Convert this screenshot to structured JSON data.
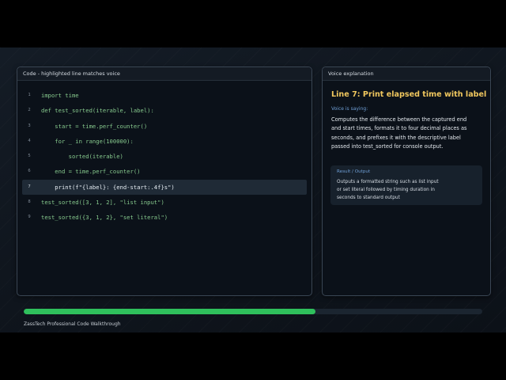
{
  "code_panel": {
    "header": "Code - highlighted line matches voice",
    "highlighted_line": 7,
    "lines": [
      {
        "num": "1",
        "text": "import time"
      },
      {
        "num": "2",
        "text": "def test_sorted(iterable, label):"
      },
      {
        "num": "3",
        "text": "    start = time.perf_counter()"
      },
      {
        "num": "4",
        "text": "    for _ in range(100000):"
      },
      {
        "num": "5",
        "text": "        sorted(iterable)"
      },
      {
        "num": "6",
        "text": "    end = time.perf_counter()"
      },
      {
        "num": "7",
        "text": "    print(f\"{label}: {end-start:.4f}s\")"
      },
      {
        "num": "8",
        "text": "test_sorted([3, 1, 2], \"list input\")"
      },
      {
        "num": "9",
        "text": "test_sorted({3, 1, 2}, \"set literal\")"
      }
    ]
  },
  "voice_panel": {
    "header": "Voice explanation",
    "title": "Line 7: Print elapsed time with label",
    "saying_label": "Voice is saying:",
    "saying_text": "Computes the difference between the captured end and start times, formats it to four decimal places as seconds, and prefixes it with the descriptive label passed into test_sorted for console output.",
    "result_label": "Result / Output",
    "result_text": "Outputs a formatted string such as list input or set literal followed by timing duration in seconds to standard output"
  },
  "progress": {
    "fraction": 0.637,
    "fill_color": "#2fc05c"
  },
  "footer": {
    "brand": "ZassTech Professional Code Walkthrough"
  }
}
